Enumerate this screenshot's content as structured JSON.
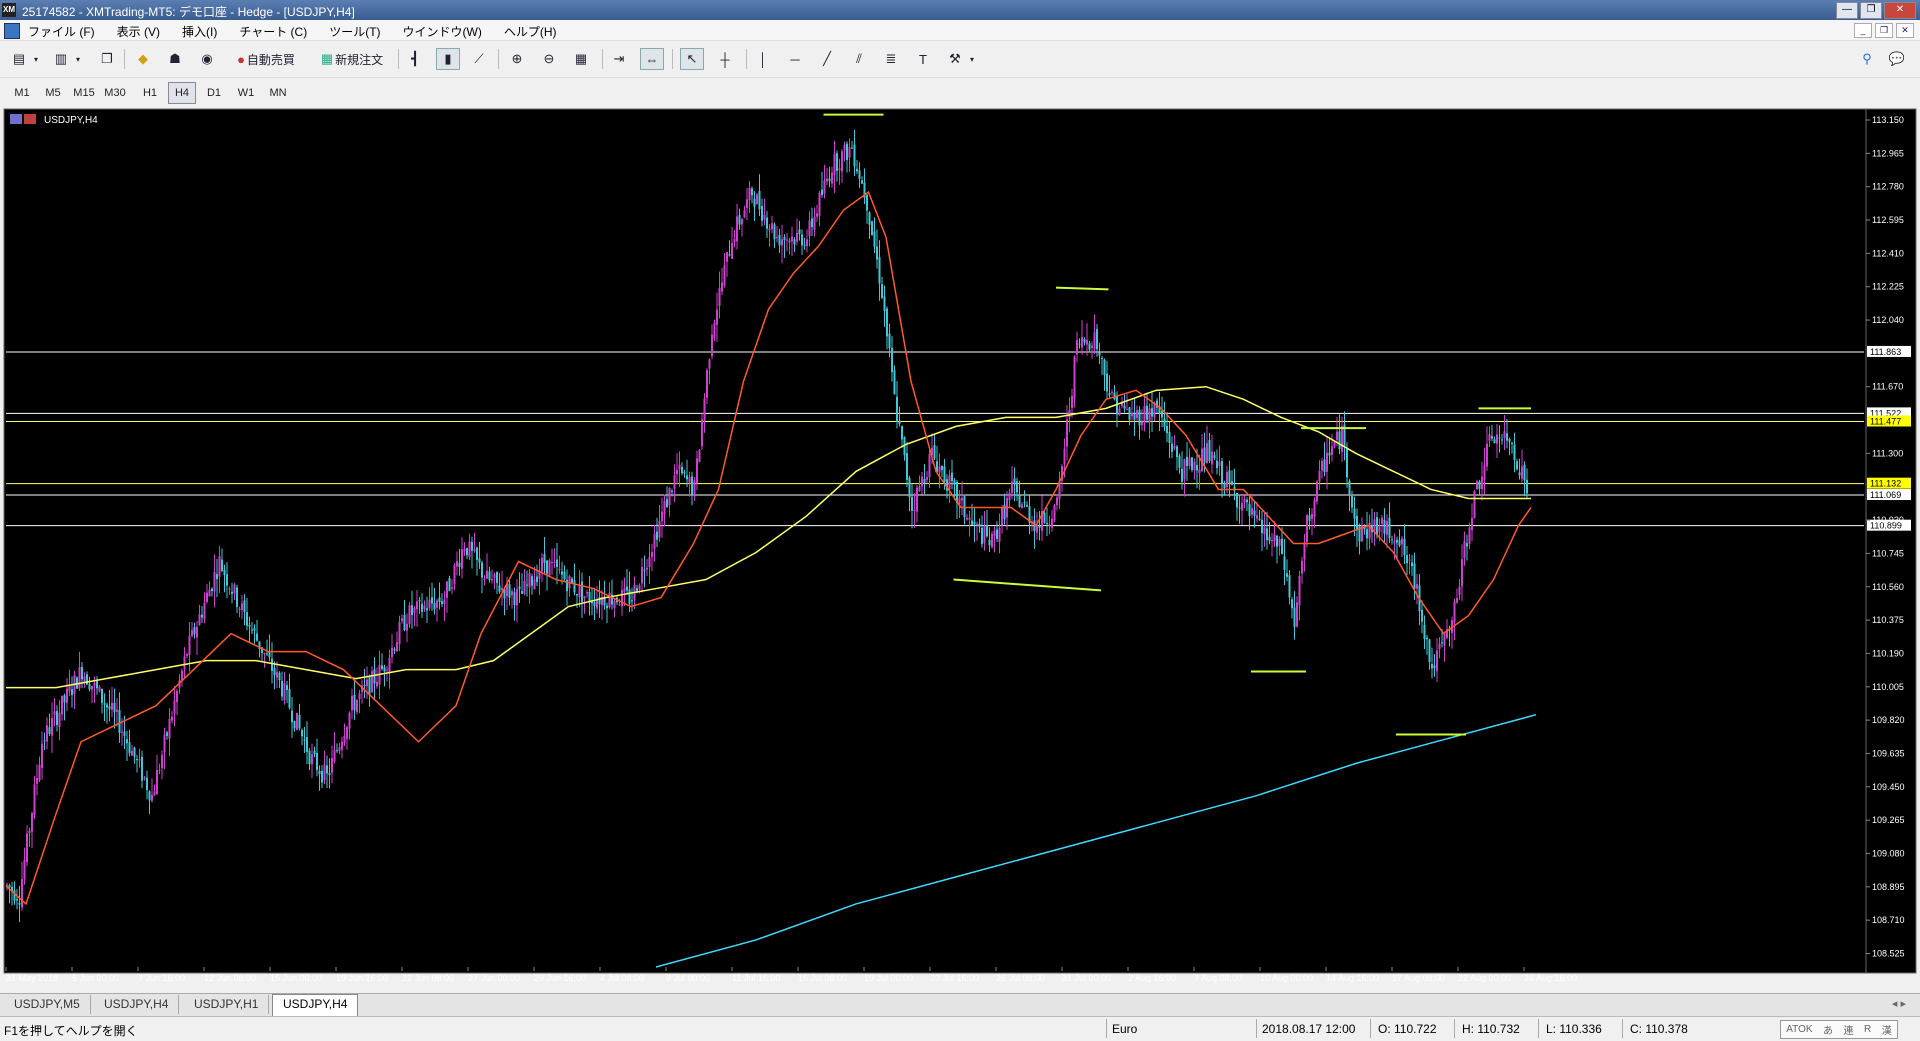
{
  "window": {
    "app_icon_text": "XM",
    "title": "25174582 - XMTrading-MT5: デモ口座 - Hedge - [USDJPY,H4]"
  },
  "menu": {
    "items": [
      "ファイル (F)",
      "表示 (V)",
      "挿入(I)",
      "チャート (C)",
      "ツール(T)",
      "ウインドウ(W)",
      "ヘルプ(H)"
    ]
  },
  "toolbar": {
    "auto_trade_label": "自動売買",
    "new_order_label": "新規注文"
  },
  "timeframes": {
    "items": [
      "M1",
      "M5",
      "M15",
      "M30",
      "H1",
      "H4",
      "D1",
      "W1",
      "MN"
    ],
    "active": "H4"
  },
  "chart": {
    "symbol_label": "USDJPY,H4",
    "background": "#000000",
    "bull_color": "#d040d0",
    "bear_color": "#40c8d8",
    "ma_fast_color": "#ff5a28",
    "ma_mid_color": "#ffff66",
    "ma_slow_color": "#40d8ff",
    "annotation_color": "#c8ff3a",
    "price_ticks": [
      "113.150",
      "112.965",
      "112.780",
      "112.595",
      "112.410",
      "112.225",
      "112.040",
      "111.670",
      "111.300",
      "110.930",
      "110.745",
      "110.560",
      "110.375",
      "110.190",
      "110.005",
      "109.820",
      "109.635",
      "109.450",
      "109.265",
      "109.080",
      "108.895",
      "108.710",
      "108.525"
    ],
    "horizontal_lines": [
      {
        "price": 111.863,
        "color": "#ffffff",
        "label": "111.863",
        "label_bg": "#ffffff",
        "label_fg": "#000000"
      },
      {
        "price": 111.522,
        "color": "#ffffff",
        "label": "111.522",
        "label_bg": "#ffffff",
        "label_fg": "#000000"
      },
      {
        "price": 111.477,
        "color": "#ffff66",
        "label": "111.477",
        "label_bg": "#ffff00",
        "label_fg": "#000000"
      },
      {
        "price": 111.132,
        "color": "#ffff66",
        "label": "111.132",
        "label_bg": "#ffff00",
        "label_fg": "#000000"
      },
      {
        "price": 111.069,
        "color": "#ffffff",
        "label": "111.069",
        "label_bg": "#ffffff",
        "label_fg": "#000000"
      },
      {
        "price": 110.899,
        "color": "#ffffff",
        "label": "110.899",
        "label_bg": "#ffffff",
        "label_fg": "#000000"
      }
    ],
    "time_labels": [
      "31 May 2018",
      "5 Jun 00:00",
      "7 Jun 16:00",
      "12 Jun 08:00",
      "15 Jun 00:00",
      "19 Jun 16:00",
      "22 Jun 08:00",
      "27 Jun 00:00",
      "29 Jun 16:00",
      "4 Jul 08:00",
      "9 Jul 00:00",
      "11 Jul 16:00",
      "16 Jul 08:00",
      "19 Jul 00:00",
      "23 Jul 16:00",
      "26 Jul 08:00",
      "31 Jul 00:00",
      "2 Aug 16:00",
      "7 Aug 08:00",
      "10 Aug 00:00",
      "14 Aug 16:00",
      "17 Aug 08:00",
      "22 Aug 00:00",
      "24 Aug 16:00"
    ]
  },
  "chart_data": {
    "type": "candlestick",
    "title": "USDJPY,H4",
    "ylim": [
      108.45,
      113.2
    ],
    "price_anchors": [
      [
        0,
        108.9
      ],
      [
        5,
        108.85
      ],
      [
        14,
        109.7
      ],
      [
        30,
        110.1
      ],
      [
        45,
        109.8
      ],
      [
        58,
        109.4
      ],
      [
        72,
        110.2
      ],
      [
        85,
        110.7
      ],
      [
        95,
        110.4
      ],
      [
        110,
        110.0
      ],
      [
        122,
        109.6
      ],
      [
        128,
        109.5
      ],
      [
        138,
        109.9
      ],
      [
        150,
        110.1
      ],
      [
        160,
        110.4
      ],
      [
        175,
        110.5
      ],
      [
        183,
        110.8
      ],
      [
        192,
        110.6
      ],
      [
        205,
        110.5
      ],
      [
        215,
        110.7
      ],
      [
        232,
        110.5
      ],
      [
        250,
        110.5
      ],
      [
        258,
        110.8
      ],
      [
        268,
        111.2
      ],
      [
        275,
        111.1
      ],
      [
        282,
        112.0
      ],
      [
        290,
        112.5
      ],
      [
        298,
        112.75
      ],
      [
        308,
        112.5
      ],
      [
        320,
        112.5
      ],
      [
        330,
        112.9
      ],
      [
        338,
        113.0
      ],
      [
        344,
        112.7
      ],
      [
        350,
        112.2
      ],
      [
        355,
        111.6
      ],
      [
        362,
        111.0
      ],
      [
        370,
        111.3
      ],
      [
        378,
        111.1
      ],
      [
        386,
        110.9
      ],
      [
        394,
        110.8
      ],
      [
        402,
        111.1
      ],
      [
        412,
        110.9
      ],
      [
        420,
        111.0
      ],
      [
        428,
        111.9
      ],
      [
        435,
        111.95
      ],
      [
        442,
        111.6
      ],
      [
        450,
        111.5
      ],
      [
        460,
        111.55
      ],
      [
        470,
        111.2
      ],
      [
        480,
        111.3
      ],
      [
        490,
        111.1
      ],
      [
        500,
        110.9
      ],
      [
        510,
        110.75
      ],
      [
        515,
        110.35
      ],
      [
        520,
        110.9
      ],
      [
        528,
        111.3
      ],
      [
        534,
        111.4
      ],
      [
        540,
        110.85
      ],
      [
        548,
        110.9
      ],
      [
        556,
        110.85
      ],
      [
        564,
        110.55
      ],
      [
        570,
        110.1
      ],
      [
        578,
        110.35
      ],
      [
        586,
        111.0
      ],
      [
        594,
        111.4
      ],
      [
        602,
        111.35
      ],
      [
        608,
        111.1
      ]
    ],
    "ma_fast_anchors": [
      [
        0,
        108.9
      ],
      [
        8,
        108.8
      ],
      [
        20,
        109.3
      ],
      [
        30,
        109.7
      ],
      [
        45,
        109.8
      ],
      [
        60,
        109.9
      ],
      [
        75,
        110.1
      ],
      [
        90,
        110.3
      ],
      [
        105,
        110.2
      ],
      [
        120,
        110.2
      ],
      [
        135,
        110.1
      ],
      [
        150,
        109.9
      ],
      [
        165,
        109.7
      ],
      [
        180,
        109.9
      ],
      [
        190,
        110.3
      ],
      [
        205,
        110.7
      ],
      [
        220,
        110.6
      ],
      [
        235,
        110.55
      ],
      [
        250,
        110.45
      ],
      [
        262,
        110.5
      ],
      [
        275,
        110.8
      ],
      [
        285,
        111.1
      ],
      [
        295,
        111.7
      ],
      [
        305,
        112.1
      ],
      [
        315,
        112.3
      ],
      [
        325,
        112.45
      ],
      [
        335,
        112.65
      ],
      [
        345,
        112.75
      ],
      [
        352,
        112.5
      ],
      [
        362,
        111.7
      ],
      [
        372,
        111.2
      ],
      [
        382,
        111.0
      ],
      [
        392,
        111.0
      ],
      [
        402,
        111.0
      ],
      [
        412,
        110.9
      ],
      [
        420,
        111.1
      ],
      [
        430,
        111.4
      ],
      [
        440,
        111.6
      ],
      [
        452,
        111.65
      ],
      [
        462,
        111.55
      ],
      [
        472,
        111.4
      ],
      [
        485,
        111.1
      ],
      [
        495,
        111.1
      ],
      [
        505,
        110.95
      ],
      [
        515,
        110.8
      ],
      [
        525,
        110.8
      ],
      [
        535,
        110.85
      ],
      [
        545,
        110.9
      ],
      [
        555,
        110.75
      ],
      [
        565,
        110.5
      ],
      [
        575,
        110.3
      ],
      [
        585,
        110.4
      ],
      [
        595,
        110.6
      ],
      [
        605,
        110.9
      ],
      [
        610,
        111.0
      ]
    ],
    "ma_mid_anchors": [
      [
        0,
        110.0
      ],
      [
        20,
        110.0
      ],
      [
        40,
        110.05
      ],
      [
        60,
        110.1
      ],
      [
        80,
        110.15
      ],
      [
        100,
        110.15
      ],
      [
        120,
        110.1
      ],
      [
        140,
        110.05
      ],
      [
        160,
        110.1
      ],
      [
        180,
        110.1
      ],
      [
        195,
        110.15
      ],
      [
        210,
        110.3
      ],
      [
        225,
        110.45
      ],
      [
        240,
        110.5
      ],
      [
        260,
        110.55
      ],
      [
        280,
        110.6
      ],
      [
        300,
        110.75
      ],
      [
        320,
        110.95
      ],
      [
        340,
        111.2
      ],
      [
        360,
        111.35
      ],
      [
        380,
        111.45
      ],
      [
        400,
        111.5
      ],
      [
        420,
        111.5
      ],
      [
        440,
        111.55
      ],
      [
        460,
        111.65
      ],
      [
        480,
        111.67
      ],
      [
        495,
        111.6
      ],
      [
        510,
        111.5
      ],
      [
        525,
        111.42
      ],
      [
        540,
        111.3
      ],
      [
        555,
        111.2
      ],
      [
        570,
        111.1
      ],
      [
        585,
        111.05
      ],
      [
        600,
        111.05
      ],
      [
        610,
        111.05
      ]
    ],
    "ma_slow_anchors": [
      [
        260,
        108.45
      ],
      [
        300,
        108.6
      ],
      [
        340,
        108.8
      ],
      [
        380,
        108.95
      ],
      [
        420,
        109.1
      ],
      [
        460,
        109.25
      ],
      [
        500,
        109.4
      ],
      [
        540,
        109.58
      ],
      [
        580,
        109.73
      ],
      [
        612,
        109.85
      ]
    ],
    "annotation_segments": [
      {
        "x1": 327,
        "y1": 113.18,
        "x2": 351,
        "y2": 113.18
      },
      {
        "x1": 420,
        "y1": 112.22,
        "x2": 441,
        "y2": 112.21
      },
      {
        "x1": 379,
        "y1": 110.6,
        "x2": 438,
        "y2": 110.54
      },
      {
        "x1": 518,
        "y1": 111.44,
        "x2": 544,
        "y2": 111.44
      },
      {
        "x1": 498,
        "y1": 110.09,
        "x2": 520,
        "y2": 110.09
      },
      {
        "x1": 589,
        "y1": 111.55,
        "x2": 610,
        "y2": 111.55
      },
      {
        "x1": 556,
        "y1": 109.74,
        "x2": 584,
        "y2": 109.74
      }
    ]
  },
  "tabs": {
    "items": [
      "USDJPY,M5",
      "USDJPY,H4",
      "USDJPY,H1",
      "USDJPY,H4"
    ],
    "active_index": 3
  },
  "statusbar": {
    "help": "F1を押してヘルプを開く",
    "profile": "Euro",
    "datetime": "2018.08.17 12:00",
    "open": "O: 110.722",
    "high": "H: 110.732",
    "low": "L: 110.336",
    "close": "C: 110.378",
    "ime": [
      "ATOK",
      "あ",
      "連",
      "R",
      "漢"
    ]
  }
}
